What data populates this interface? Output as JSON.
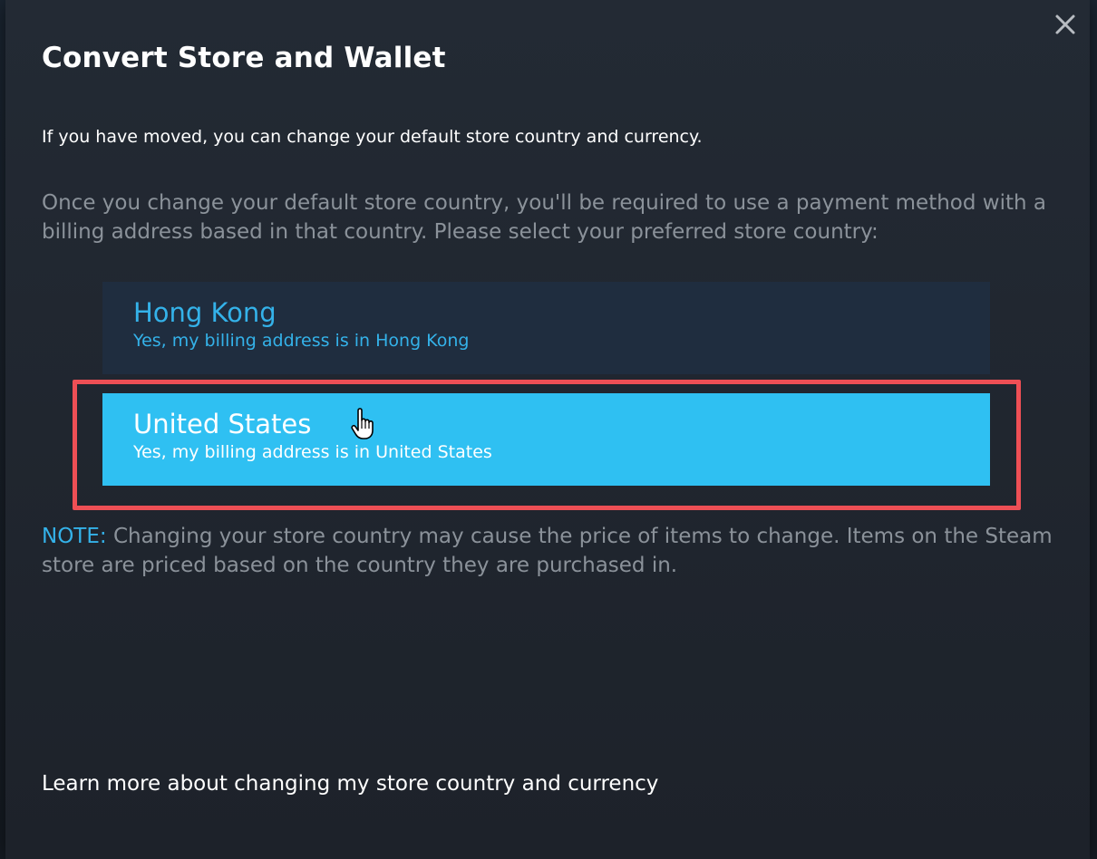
{
  "dialog": {
    "title": "Convert Store and Wallet",
    "intro": "If you have moved, you can change your default store country and currency.",
    "explanation": "Once you change your default store country, you'll be required to use a payment method with a billing address based in that country. Please select your preferred store country:",
    "options": [
      {
        "name": "Hong Kong",
        "subtitle": "Yes, my billing address is in Hong Kong",
        "state": "default"
      },
      {
        "name": "United States",
        "subtitle": "Yes, my billing address is in United States",
        "state": "hovered"
      }
    ],
    "note": {
      "label": "NOTE:",
      "text": " Changing your store country may cause the price of items to change. Items on the Steam store are priced based on the country they are purchased in."
    },
    "learn_more_link": "Learn more about changing my store country and currency",
    "close_icon": "close-icon"
  },
  "colors": {
    "accent_blue": "#34b2e9",
    "selected_option_bg": "#2fc0f2",
    "highlight_border": "#ee4f55",
    "muted_text": "#8b929a"
  }
}
